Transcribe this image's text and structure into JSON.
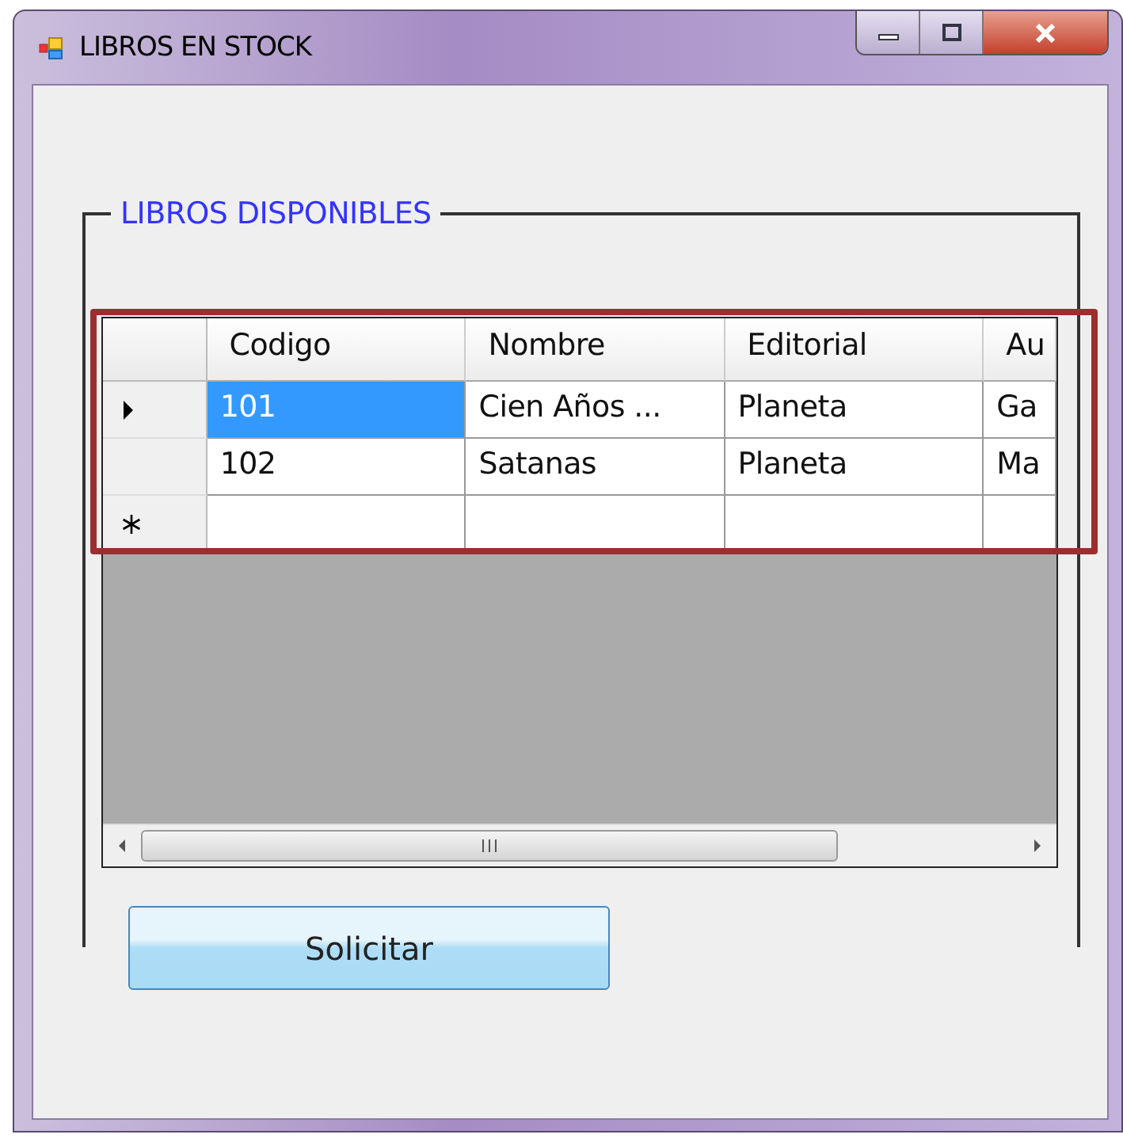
{
  "window": {
    "title": "LIBROS EN STOCK"
  },
  "group": {
    "title": "LIBROS DISPONIBLES"
  },
  "table": {
    "columns": [
      "Codigo",
      "Nombre",
      "Editorial",
      "Au"
    ],
    "rows": [
      {
        "kind": "data",
        "current": true,
        "cells": [
          {
            "text": "101",
            "selected": true
          },
          {
            "text": "Cien Años ...",
            "selected": false
          },
          {
            "text": "Planeta",
            "selected": false
          },
          {
            "text": "Ga",
            "selected": false
          }
        ]
      },
      {
        "kind": "data",
        "current": false,
        "cells": [
          {
            "text": "102",
            "selected": false
          },
          {
            "text": "Satanas",
            "selected": false
          },
          {
            "text": "Planeta",
            "selected": false
          },
          {
            "text": "Ma",
            "selected": false
          }
        ]
      },
      {
        "kind": "new",
        "current": false,
        "cells": []
      }
    ]
  },
  "buttons": [
    "Solicitar"
  ]
}
